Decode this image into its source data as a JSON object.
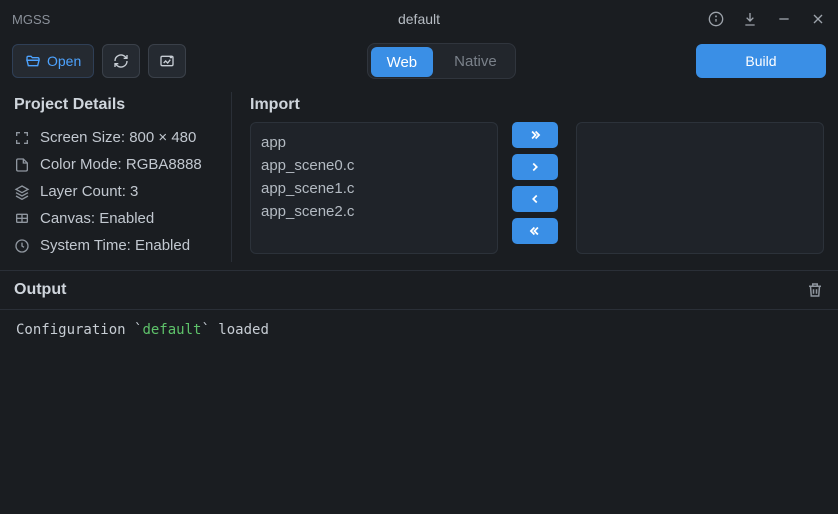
{
  "titlebar": {
    "appname": "MGSS",
    "title": "default"
  },
  "toolbar": {
    "open": "Open",
    "segments": {
      "web": "Web",
      "native": "Native"
    },
    "build": "Build"
  },
  "details": {
    "title": "Project Details",
    "screen": "Screen Size: 800 × 480",
    "color": "Color Mode: RGBA8888",
    "layers": "Layer Count: 3",
    "canvas": "Canvas: Enabled",
    "time": "System Time: Enabled"
  },
  "import": {
    "title": "Import",
    "left": [
      "app",
      "app_scene0.c",
      "app_scene1.c",
      "app_scene2.c"
    ]
  },
  "output": {
    "title": "Output",
    "line_prefix": "Configuration `",
    "line_name": "default",
    "line_suffix": "` loaded"
  }
}
